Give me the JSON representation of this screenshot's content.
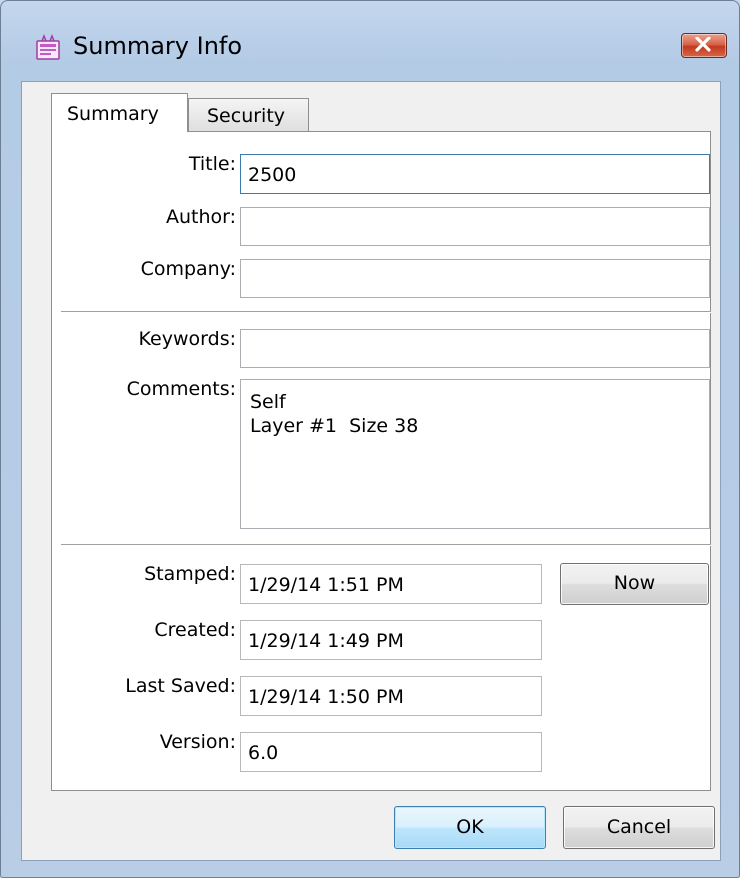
{
  "window": {
    "title": "Summary Info",
    "icon": "summary-info-app-icon",
    "close_icon": "close-icon"
  },
  "tabs": [
    {
      "label": "Summary",
      "selected": true
    },
    {
      "label": "Security",
      "selected": false
    }
  ],
  "fields": {
    "title": {
      "label": "Title:",
      "value": "2500"
    },
    "author": {
      "label": "Author:",
      "value": ""
    },
    "company": {
      "label": "Company:",
      "value": ""
    },
    "keywords": {
      "label": "Keywords:",
      "value": ""
    },
    "comments": {
      "label": "Comments:",
      "value": "Self\nLayer #1  Size 38"
    },
    "stamped": {
      "label": "Stamped:",
      "value": "1/29/14 1:51 PM"
    },
    "created": {
      "label": "Created:",
      "value": "1/29/14 1:49 PM"
    },
    "last_saved": {
      "label": "Last Saved:",
      "value": "1/29/14 1:50 PM"
    },
    "version": {
      "label": "Version:",
      "value": "6.0"
    }
  },
  "buttons": {
    "now": "Now",
    "ok": "OK",
    "cancel": "Cancel"
  },
  "colors": {
    "frame": "#b9cde5",
    "close_button": "#c3391c",
    "default_button_border": "#3c7fb1"
  }
}
